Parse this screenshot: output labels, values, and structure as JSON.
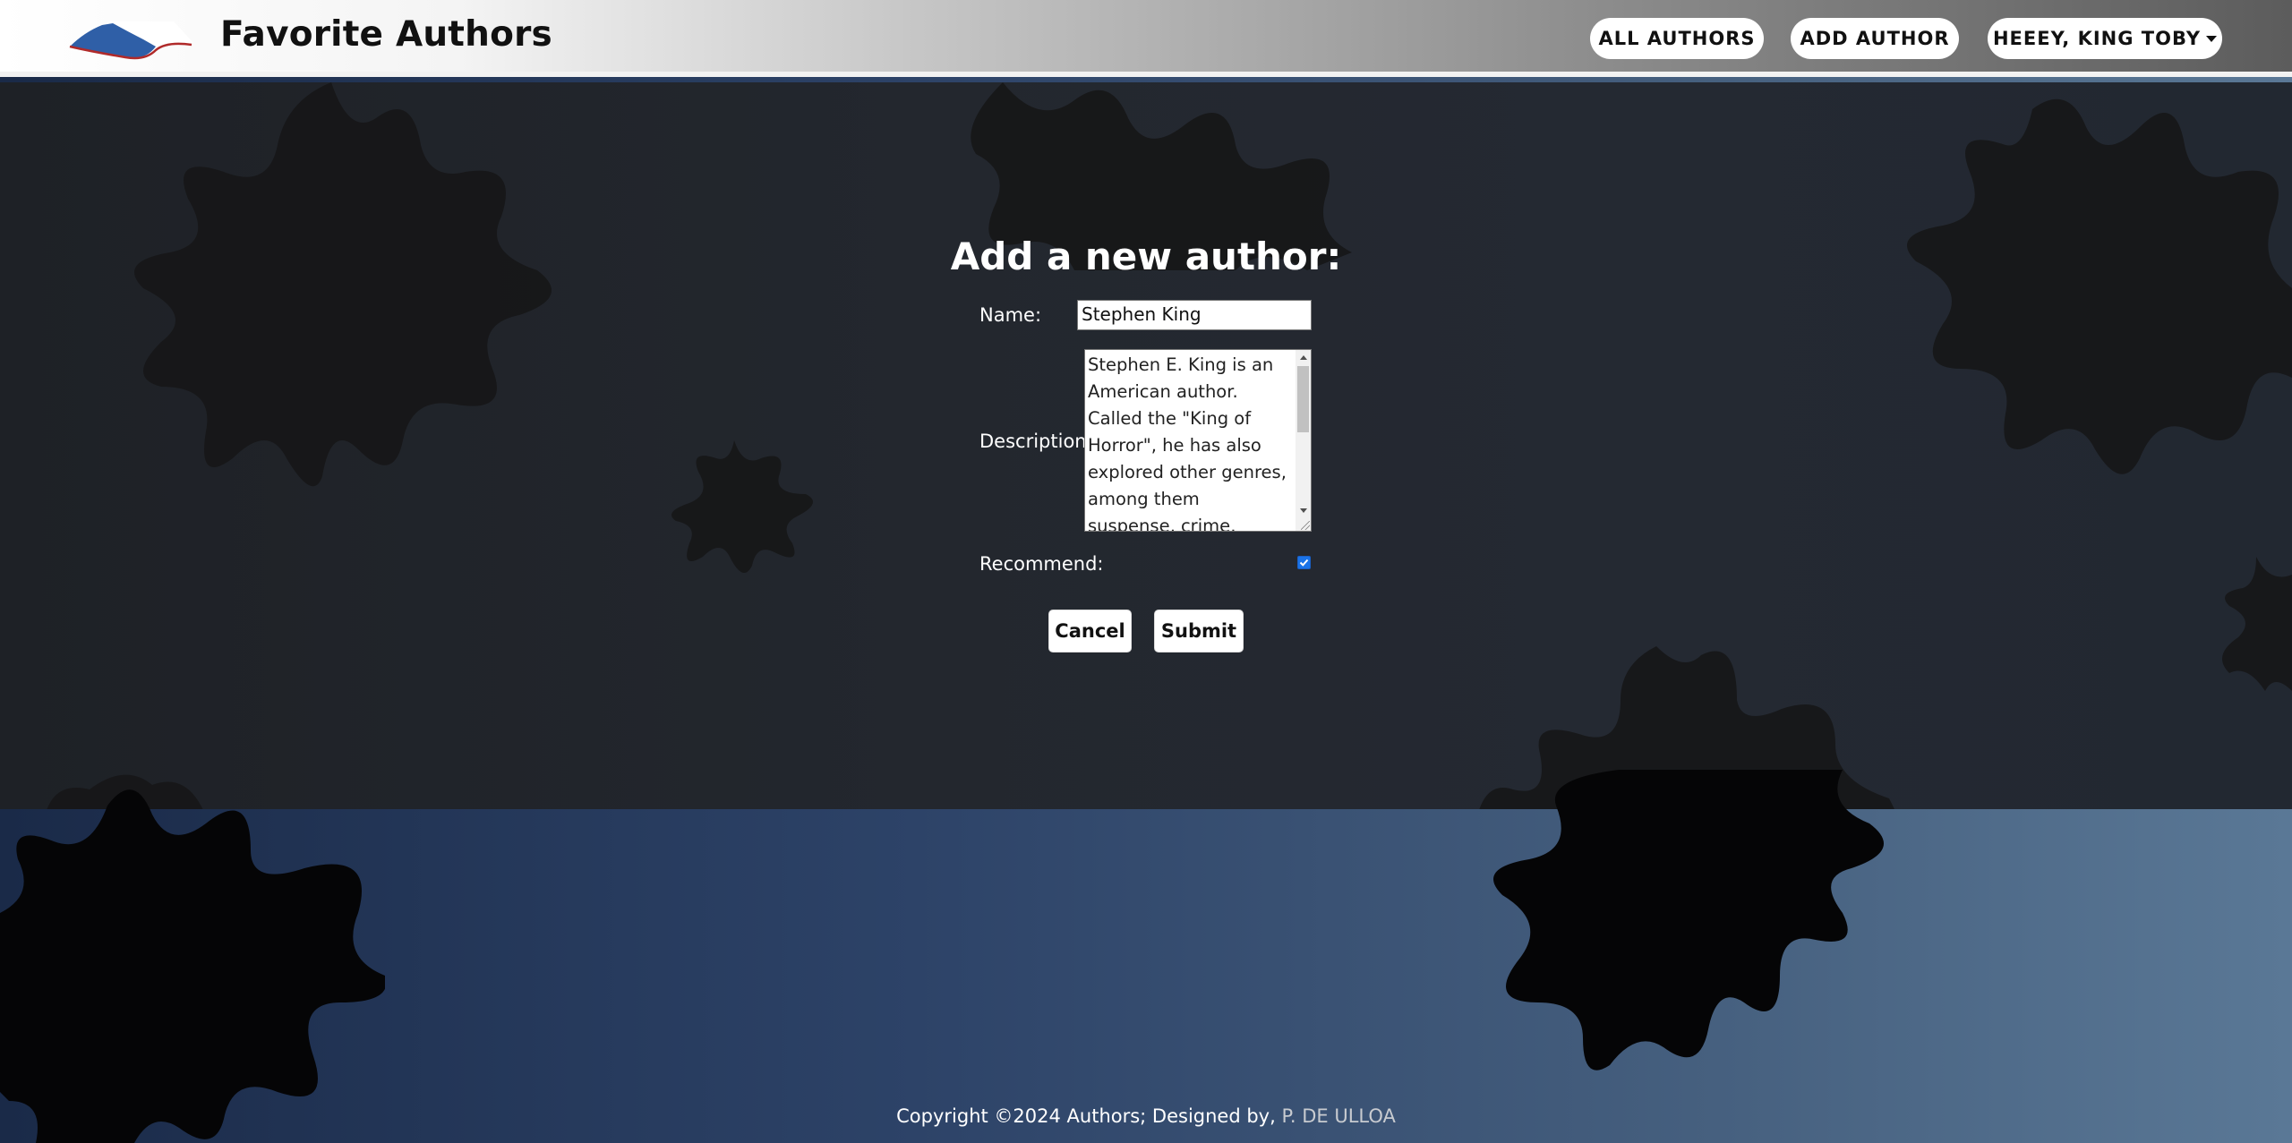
{
  "header": {
    "brand": "Favorite Authors",
    "nav": {
      "all_authors": "ALL AUTHORS",
      "add_author": "ADD AUTHOR",
      "user_menu": "HEEEY, KING TOBY"
    }
  },
  "form": {
    "title": "Add a new author:",
    "name_label": "Name:",
    "name_value": "Stephen King",
    "description_label": "Description:",
    "description_value": "Stephen E. King is an American author. Called the \"King of Horror\", he has also explored other genres, among them suspense, crime, science-fiction, fantasy and",
    "recommend_label": "Recommend:",
    "recommend_checked": true,
    "cancel_label": "Cancel",
    "submit_label": "Submit"
  },
  "footer": {
    "copyright": "Copyright ©2024 Authors; Designed by, ",
    "designer": "P. DE ULLOA"
  },
  "colors": {
    "checkbox_accent": "#1a73e8"
  },
  "icons": {
    "logo": "wave-logo-icon",
    "caret": "caret-down-icon",
    "check": "checkmark-icon"
  }
}
